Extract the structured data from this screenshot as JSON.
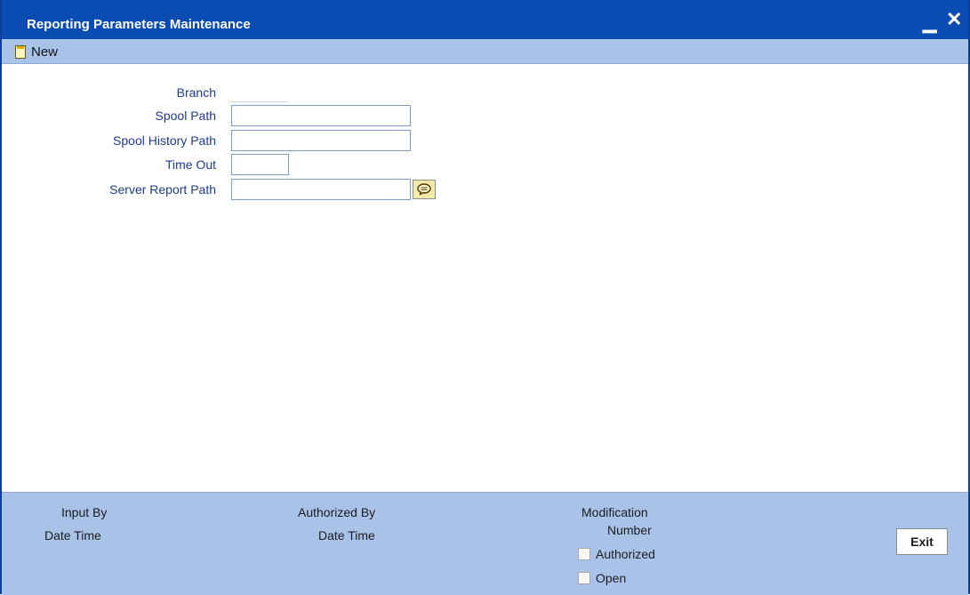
{
  "window": {
    "title": "Reporting Parameters Maintenance",
    "minimize_icon": "minimize-icon",
    "close_icon": "close-icon"
  },
  "toolbar": {
    "new_label": "New",
    "new_icon": "new-document-icon"
  },
  "form": {
    "branch_label": "Branch",
    "branch_value": "",
    "spool_path_label": "Spool Path",
    "spool_path_value": "",
    "spool_history_path_label": "Spool History Path",
    "spool_history_path_value": "",
    "time_out_label": "Time Out",
    "time_out_value": "",
    "server_report_path_label": "Server Report Path",
    "server_report_path_value": "",
    "lov_icon": "list-of-values-icon"
  },
  "footer": {
    "input_by_label": "Input By",
    "input_date_time_label": "Date Time",
    "authorized_by_label": "Authorized By",
    "authorized_date_time_label": "Date Time",
    "modification_label_line1": "Modification",
    "modification_label_line2": "Number",
    "authorized_checkbox_label": "Authorized",
    "open_checkbox_label": "Open",
    "exit_label": "Exit"
  },
  "colors": {
    "title_bar": "#0b4cb3",
    "toolbar_footer": "#a9c3e8",
    "label_text": "#1e3b8c"
  }
}
